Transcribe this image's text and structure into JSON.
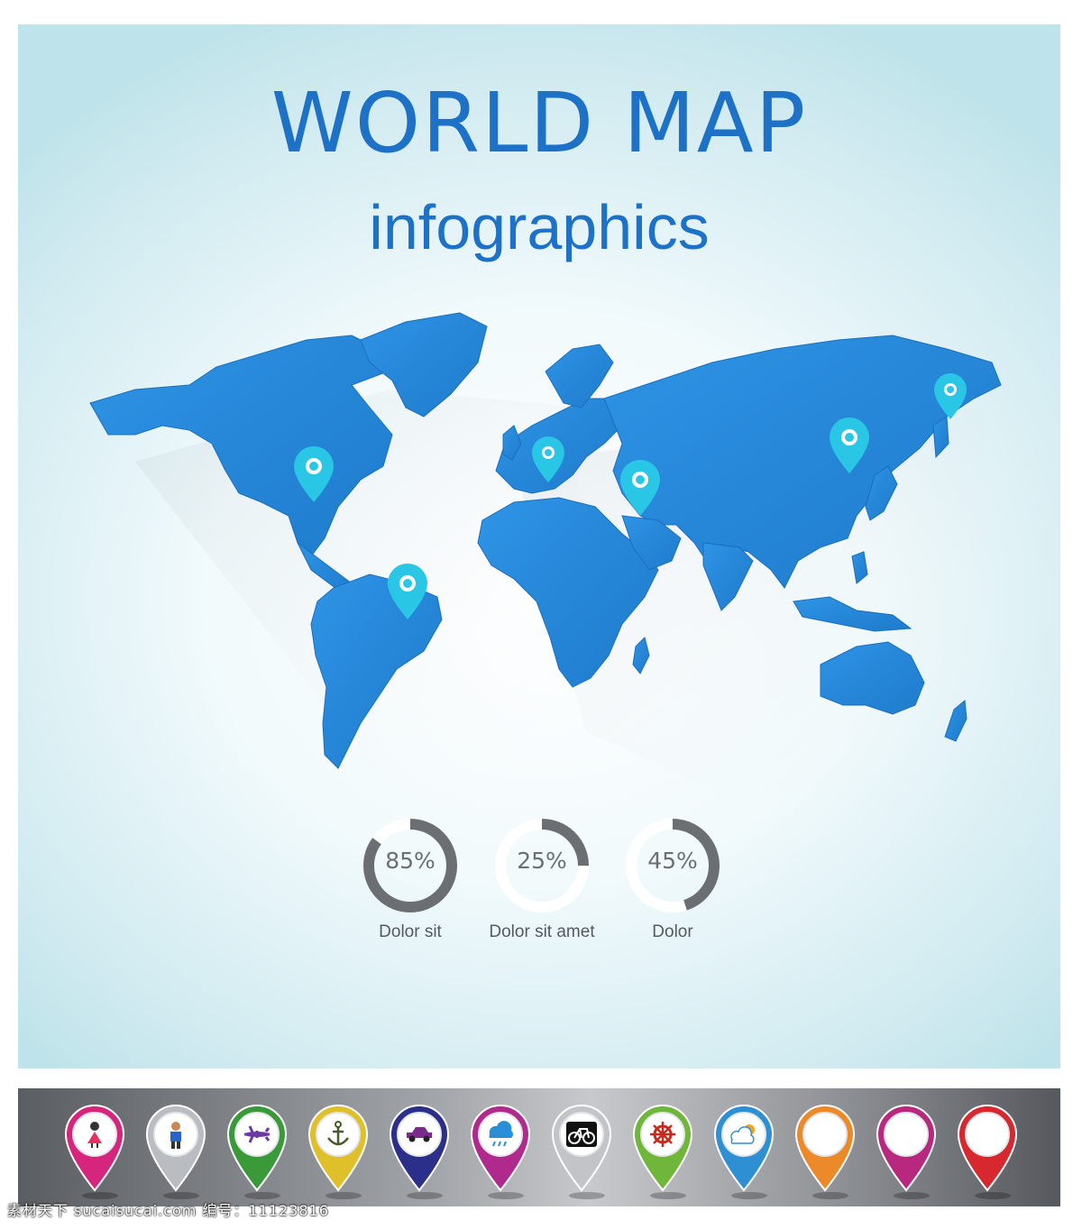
{
  "title": "WORLD MAP",
  "subtitle": "infographics",
  "colors": {
    "accent": "#1d72c8",
    "map": "#2b8ee0",
    "pin": "#29c6e6",
    "gauge": "#6b6f73"
  },
  "map_markers": [
    {
      "name": "north-america-pin-icon"
    },
    {
      "name": "south-america-pin-icon"
    },
    {
      "name": "europe-pin-icon"
    },
    {
      "name": "middle-east-pin-icon"
    },
    {
      "name": "east-asia-pin-icon"
    },
    {
      "name": "far-east-pin-icon"
    }
  ],
  "gauges": [
    {
      "value_text": "85%",
      "value": 0.85,
      "label": "Dolor sit"
    },
    {
      "value_text": "25%",
      "value": 0.25,
      "label": "Dolor sit amet"
    },
    {
      "value_text": "45%",
      "value": 0.45,
      "label": "Dolor"
    }
  ],
  "icon_pins": [
    {
      "icon": "woman-icon",
      "color": "#d6257c"
    },
    {
      "icon": "man-icon",
      "color": "#b9bcc0"
    },
    {
      "icon": "airplane-icon",
      "color": "#3a9a3a"
    },
    {
      "icon": "anchor-icon",
      "color": "#e0c02a"
    },
    {
      "icon": "car-icon",
      "color": "#2b2f8a"
    },
    {
      "icon": "rain-cloud-icon",
      "color": "#b02a8e"
    },
    {
      "icon": "bicycle-icon",
      "color": "#c2c4c7"
    },
    {
      "icon": "ship-wheel-icon",
      "color": "#6fb63a"
    },
    {
      "icon": "cloud-sun-icon",
      "color": "#2f8fd3"
    },
    {
      "icon": "blank-pin-icon",
      "color": "#ec8a2a"
    },
    {
      "icon": "blank-pin-icon",
      "color": "#b8287f"
    },
    {
      "icon": "blank-pin-icon",
      "color": "#d6282e"
    }
  ],
  "watermark": "素材天下 sucaisucai.com  编号：11123816"
}
